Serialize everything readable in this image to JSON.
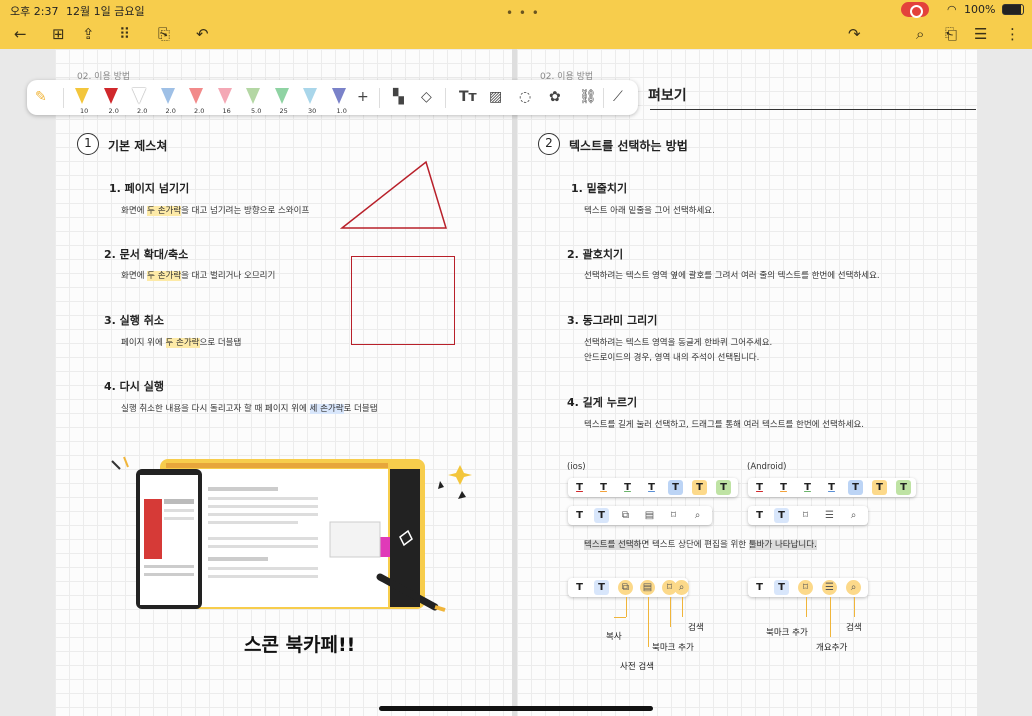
{
  "status": {
    "time": "오후 2:37",
    "date": "12월 1일 금요일",
    "battery": "100%"
  },
  "crumb_left": "02. 이용 방법",
  "crumb_right": "02. 이용 방법",
  "title_fragment": "펴보기",
  "toolbar": {
    "pens": [
      {
        "color": "#f3c63c",
        "size": "10"
      },
      {
        "color": "#d0282c",
        "size": "2.0"
      },
      {
        "color": "#ffffff",
        "size": "2.0"
      },
      {
        "color": "#9fc0e6",
        "size": "2.0"
      },
      {
        "color": "#f28a8a",
        "size": "2.0"
      },
      {
        "color": "#f4a8b5",
        "size": "16"
      },
      {
        "color": "#b4d7a4",
        "size": "5.0"
      },
      {
        "color": "#8fd3a3",
        "size": "25"
      },
      {
        "color": "#a9d6ea",
        "size": "30"
      },
      {
        "color": "#7a82c9",
        "size": "1.0"
      }
    ],
    "add": "+"
  },
  "left": {
    "section_num": "1",
    "section_title": "기본 제스쳐",
    "items": [
      {
        "h": "1. 페이지 넘기기",
        "pre": "화면에 ",
        "hl": "두 손가락",
        "post": "을 대고 넘기려는 방향으로 스와이프"
      },
      {
        "h": "2. 문서 확대/축소",
        "pre": "화면에 ",
        "hl": "두 손가락",
        "post": "을 대고 벌리거나 오므리기"
      },
      {
        "h": "3. 실행 취소",
        "pre": "페이지 위에 ",
        "hl": "두 손가락",
        "post": "으로 더블탭"
      },
      {
        "h": "4. 다시 실행",
        "pre": "실행 취소한 내용을 다시 돌리고자 할 때 페이지 위에 ",
        "hl": "세 손가락",
        "post": "로 더블탭"
      }
    ],
    "caption": "스콘 북카페!!"
  },
  "right": {
    "section_num": "2",
    "section_title": "텍스트를 선택하는 방법",
    "items": [
      {
        "h": "1. 밑줄치기",
        "p1": "텍스트 아래 밑줄을 그어 선택하세요.",
        "p2": ""
      },
      {
        "h": "2. 괄호치기",
        "p1": "선택하려는 텍스트 영역 옆에 괄호를 그려서 여러 줄의 텍스트를 한번에 선택하세요.",
        "p2": ""
      },
      {
        "h": "3. 동그라미 그리기",
        "p1": "선택하려는 텍스트 영역을 동글게 한바퀴 그어주세요.",
        "p2": "안드로이드의 경우, 영역 내의 주석이 선택됩니다."
      },
      {
        "h": "4. 길게 누르기",
        "p1": "텍스트를 길게 눌러 선택하고, 드래그를 통해 여러 텍스트를 한번에 선택하세요.",
        "p2": ""
      }
    ],
    "ios_label": "(ios)",
    "android_label": "(Android)",
    "note_pre": "텍스트를 선택하",
    "note_mid": "면 텍스트 상단에 편집을 위한 ",
    "note_end": "툴바가 나타납니다.",
    "labels": {
      "copy": "복사",
      "dict": "사전 검색",
      "bookmark": "북마크 추가",
      "search": "검색",
      "bookmark2": "북마크 추가",
      "search2": "검색",
      "line_add": "개요추가"
    }
  }
}
